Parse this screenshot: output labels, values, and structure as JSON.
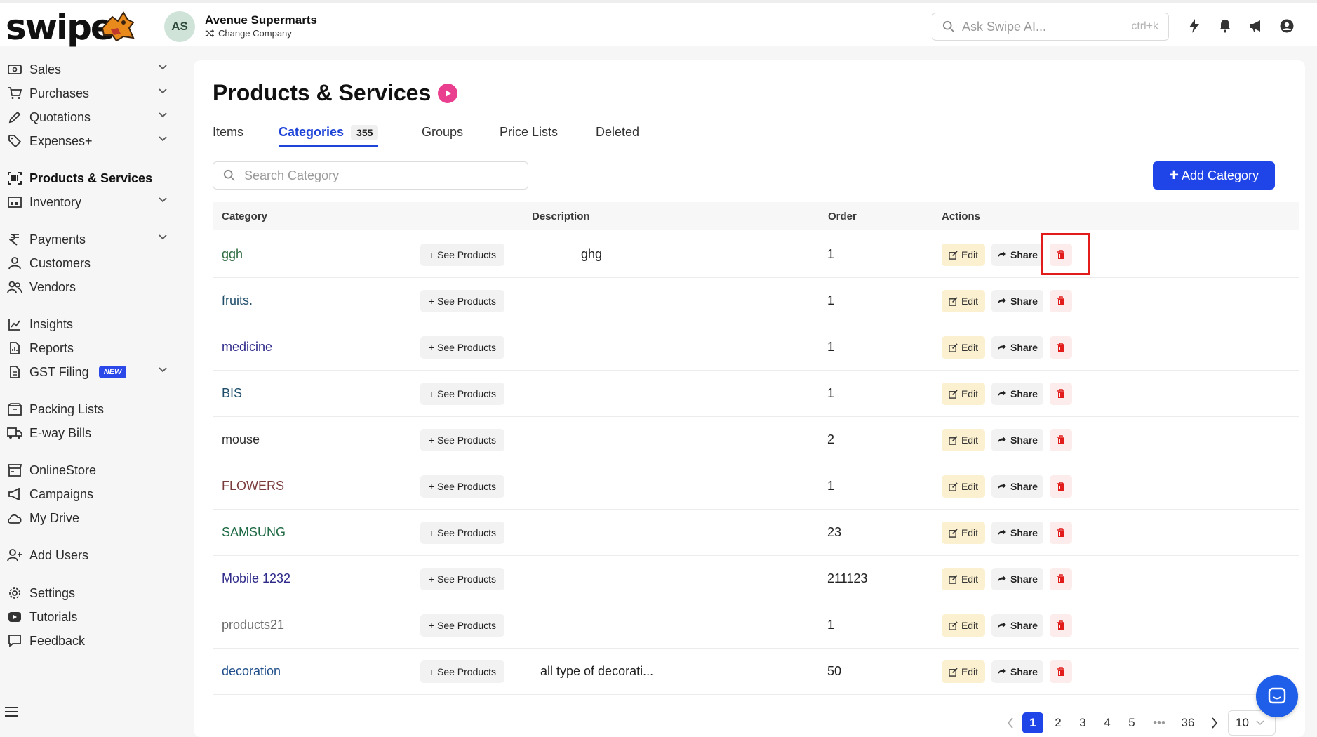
{
  "header": {
    "logo_text": "swipe",
    "avatar_initials": "AS",
    "company_name": "Avenue Supermarts",
    "change_company": "Change Company",
    "search_placeholder": "Ask Swipe AI...",
    "search_shortcut": "ctrl+k"
  },
  "sidebar": {
    "items": [
      {
        "label": "Sales",
        "icon": "cash-icon"
      },
      {
        "label": "Purchases",
        "icon": "cart-icon"
      },
      {
        "label": "Quotations",
        "icon": "pen-icon"
      },
      {
        "label": "Expenses+",
        "icon": "tag-icon"
      },
      {
        "label": "Products & Services",
        "icon": "barcode-icon"
      },
      {
        "label": "Inventory",
        "icon": "warehouse-icon"
      },
      {
        "label": "Payments",
        "icon": "rupee-icon"
      },
      {
        "label": "Customers",
        "icon": "user-icon"
      },
      {
        "label": "Vendors",
        "icon": "users-icon"
      },
      {
        "label": "Insights",
        "icon": "chart-icon"
      },
      {
        "label": "Reports",
        "icon": "report-icon"
      },
      {
        "label": "GST Filing",
        "icon": "file-icon",
        "badge": "NEW"
      },
      {
        "label": "Packing Lists",
        "icon": "box-icon"
      },
      {
        "label": "E-way Bills",
        "icon": "truck-icon"
      },
      {
        "label": "OnlineStore",
        "icon": "store-icon"
      },
      {
        "label": "Campaigns",
        "icon": "megaphone-icon"
      },
      {
        "label": "My Drive",
        "icon": "cloud-icon"
      },
      {
        "label": "Add Users",
        "icon": "user-plus-icon"
      },
      {
        "label": "Settings",
        "icon": "gear-icon"
      },
      {
        "label": "Tutorials",
        "icon": "youtube-icon"
      },
      {
        "label": "Feedback",
        "icon": "message-icon"
      }
    ]
  },
  "main": {
    "title": "Products & Services",
    "tabs": [
      {
        "label": "Items"
      },
      {
        "label": "Categories",
        "count": "355"
      },
      {
        "label": "Groups"
      },
      {
        "label": "Price Lists"
      },
      {
        "label": "Deleted"
      }
    ],
    "search_placeholder": "Search Category",
    "add_button": "Add Category",
    "columns": [
      "Category",
      "Description",
      "Order",
      "Actions"
    ],
    "see_products_label": "+ See Products",
    "edit_label": "Edit",
    "share_label": "Share",
    "rows": [
      {
        "name": "ggh",
        "color": "#2e6b3f",
        "description": "ghg",
        "order": "1"
      },
      {
        "name": "fruits.",
        "color": "#1f4e6b",
        "description": "",
        "order": "1"
      },
      {
        "name": "medicine",
        "color": "#2e2a8a",
        "description": "",
        "order": "1"
      },
      {
        "name": "BIS",
        "color": "#1f4e6b",
        "description": "",
        "order": "1"
      },
      {
        "name": "mouse",
        "color": "#2a2a2a",
        "description": "",
        "order": "2"
      },
      {
        "name": "FLOWERS",
        "color": "#7a3b3b",
        "description": "",
        "order": "1"
      },
      {
        "name": "SAMSUNG",
        "color": "#1f6b45",
        "description": "",
        "order": "23"
      },
      {
        "name": "Mobile 1232",
        "color": "#2e2a8a",
        "description": "",
        "order": "211123"
      },
      {
        "name": "products21",
        "color": "#6a6a6a",
        "description": "",
        "order": "1"
      },
      {
        "name": "decoration",
        "color": "#1f4e8a",
        "description": "all type of decorati...",
        "order": "50"
      }
    ]
  },
  "pagination": {
    "pages": [
      "1",
      "2",
      "3",
      "4",
      "5",
      "36"
    ],
    "ellipsis": "•••",
    "current": "1",
    "page_size": "10"
  }
}
